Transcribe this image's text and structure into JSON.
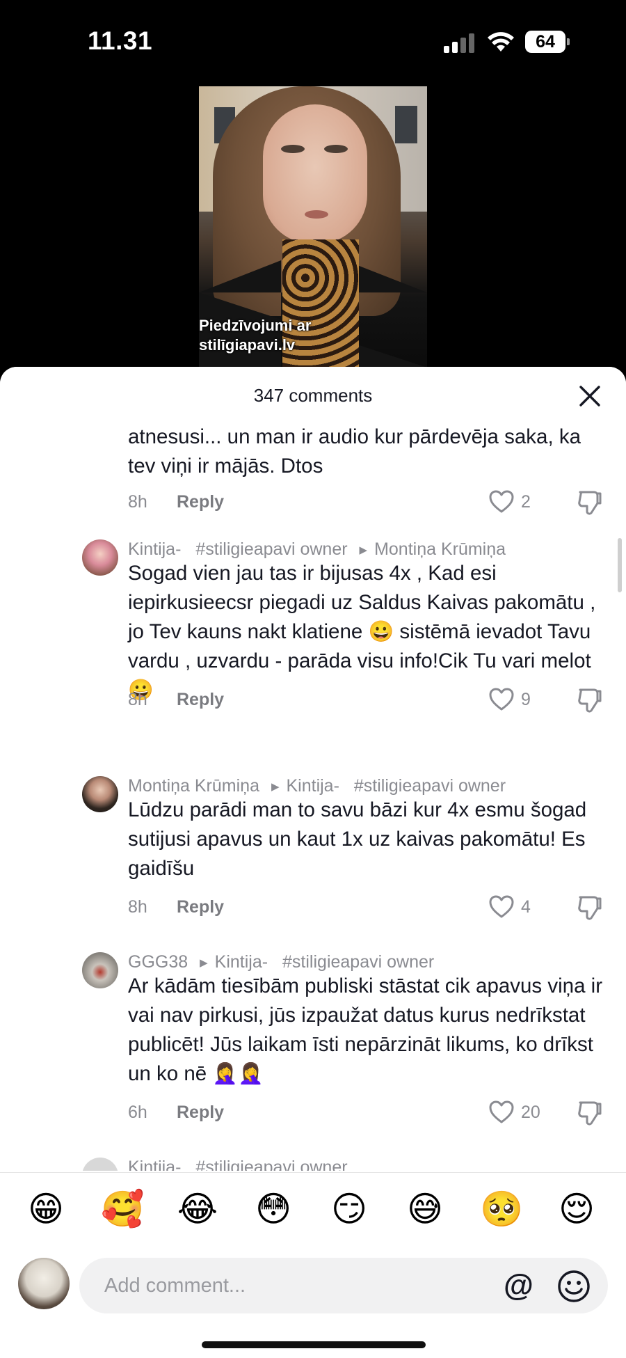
{
  "status_bar": {
    "time": "11.31",
    "battery": "64"
  },
  "video": {
    "caption_line1": "Piedzīvojumi ar",
    "caption_line2": "stilīgiapavi.lv"
  },
  "sheet": {
    "title": "347 comments"
  },
  "comments": [
    {
      "body": "atnesusi... un man ir audio kur pārdevēja saka, ka tev viņi ir mājās. Dtos",
      "time": "8h",
      "reply": "Reply",
      "likes": "2"
    },
    {
      "author": "Kintija-",
      "author_tag": "#stiligieapavi owner",
      "reply_to": "Montiņa Krūmiņa",
      "body": "Sogad vien jau tas ir bijusas 4x , Kad esi iepirkusieecsr piegadi uz Saldus Kaivas pakomātu , jo Tev kauns nakt klatiene 😀 sistēmā ievadot Tavu vardu , uzvardu - parāda visu info!Cik Tu vari melot😀",
      "time": "8h",
      "reply": "Reply",
      "likes": "9"
    },
    {
      "author": "Montiņa Krūmiņa",
      "reply_to": "Kintija-",
      "reply_to_tag": "#stiligieapavi owner",
      "body": "Lūdzu parādi man to savu bāzi kur 4x esmu šogad sutijusi apavus un kaut 1x uz kaivas pakomātu! Es gaidīšu",
      "time": "8h",
      "reply": "Reply",
      "likes": "4"
    },
    {
      "author": "GGG38",
      "reply_to": "Kintija-",
      "reply_to_tag": "#stiligieapavi owner",
      "body": "Ar kādām tiesībām publiski stāstat cik apavus viņa ir vai nav pirkusi, jūs izpaužat datus kurus nedrīkstat publicēt! Jūs laikam īsti nepārzināt likums, ko drīkst un ko nē 🤦‍♀️🤦‍♀️",
      "time": "6h",
      "reply": "Reply",
      "likes": "20"
    },
    {
      "author": "Kintija-",
      "author_tag": "#stiligieapavi owner"
    }
  ],
  "emoji_bar": [
    "😁",
    "🥰",
    "😂",
    "😳",
    "😏",
    "😅",
    "🥺",
    "😌"
  ],
  "composer": {
    "placeholder": "Add comment...",
    "at": "@"
  }
}
